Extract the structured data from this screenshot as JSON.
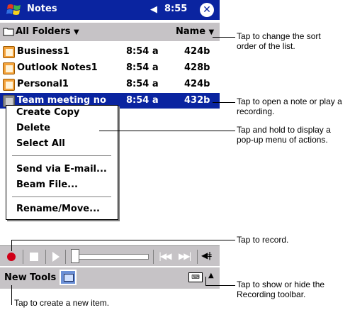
{
  "titlebar": {
    "app": "Notes",
    "speaker": "◀",
    "time": "8:55",
    "close": "✕"
  },
  "folderbar": {
    "folder": "All Folders",
    "sort": "Name"
  },
  "notes": [
    {
      "name": "Business1",
      "time": "8:54 a",
      "size": "424b"
    },
    {
      "name": "Outlook Notes1",
      "time": "8:54 a",
      "size": "428b"
    },
    {
      "name": "Personal1",
      "time": "8:54 a",
      "size": "424b"
    },
    {
      "name": "Team meeting no",
      "time": "8:54 a",
      "size": "432b"
    }
  ],
  "popup": {
    "items": [
      "Create Copy",
      "Delete",
      "Select All",
      "Send via E-mail...",
      "Beam File...",
      "Rename/Move..."
    ]
  },
  "menubar": {
    "new": "New",
    "tools": "Tools"
  },
  "callouts": {
    "sort": "Tap to change the sort order of the list.",
    "open": "Tap to open a note or play a recording.",
    "hold": "Tap and hold to display a pop-up menu of actions.",
    "record": "Tap to record.",
    "toggle": "Tap to show or hide the Recording toolbar.",
    "create": "Tap to create a new item."
  },
  "colors": {
    "titlebar": "#0a24a0",
    "bars": "#c6c3c6",
    "record": "#d00018"
  }
}
